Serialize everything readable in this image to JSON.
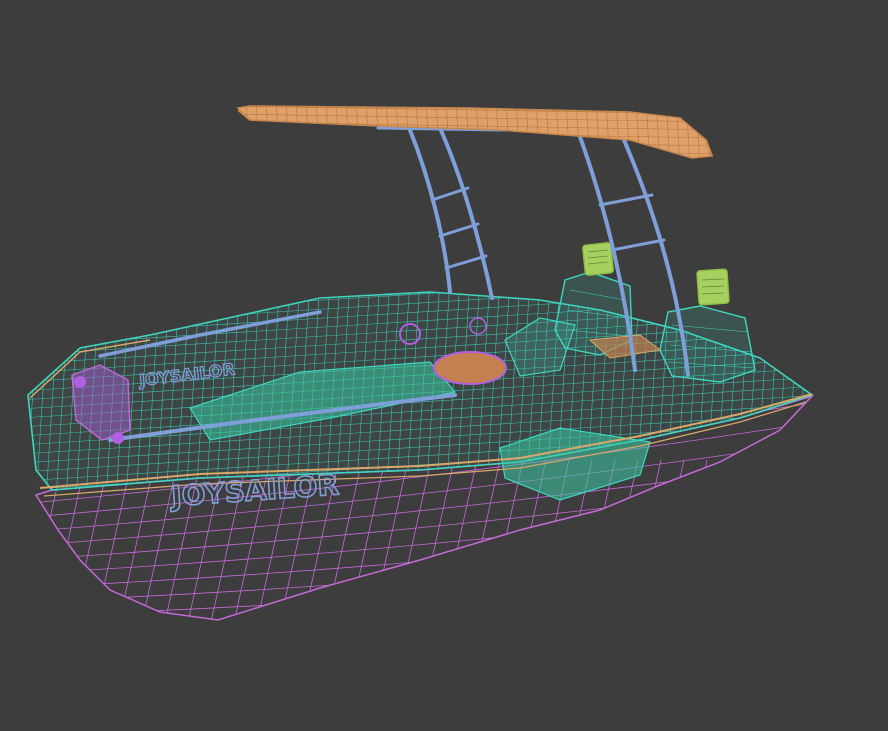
{
  "viewport": {
    "background": "#3d3d3d",
    "model": "wireframe boat"
  },
  "colors": {
    "hull": "#c46ad6",
    "deck": "#3fd6c0",
    "deck_fill": "#3cc8a4",
    "canopy": "#e0a06a",
    "frame": "#7f9fd8",
    "trim": "#d8a86a",
    "screen": "#a8d060",
    "accent": "#b060e0"
  },
  "hull_text": {
    "side": "JOYSAILOR",
    "inner": "JOYSAILOR"
  }
}
